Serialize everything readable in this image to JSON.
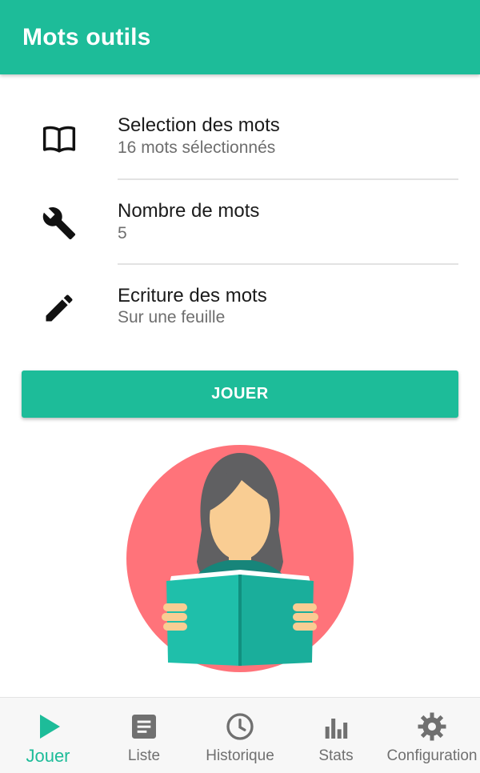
{
  "appbar": {
    "title": "Mots outils"
  },
  "settings": [
    {
      "title": "Selection des mots",
      "value": "16 mots sélectionnés",
      "icon": "book-open-icon"
    },
    {
      "title": "Nombre de mots",
      "value": "5",
      "icon": "wrench-icon"
    },
    {
      "title": "Ecriture des mots",
      "value": "Sur une feuille",
      "icon": "pencil-icon"
    }
  ],
  "play_button": {
    "label": "JOUER"
  },
  "illustration": {
    "description_icon": "woman-reading-book-illustration"
  },
  "bottom_nav": {
    "items": [
      {
        "label": "Jouer",
        "icon": "play-icon",
        "active": true
      },
      {
        "label": "Liste",
        "icon": "list-icon",
        "active": false
      },
      {
        "label": "Historique",
        "icon": "clock-icon",
        "active": false
      },
      {
        "label": "Stats",
        "icon": "bar-chart-icon",
        "active": false
      },
      {
        "label": "Configuration",
        "icon": "gear-icon",
        "active": false
      }
    ]
  },
  "colors": {
    "primary": "#1dbc99",
    "circle": "#ff737a",
    "text_primary": "#1b1b1b",
    "text_secondary": "#6e6e6e",
    "nav_inactive": "#707070"
  }
}
